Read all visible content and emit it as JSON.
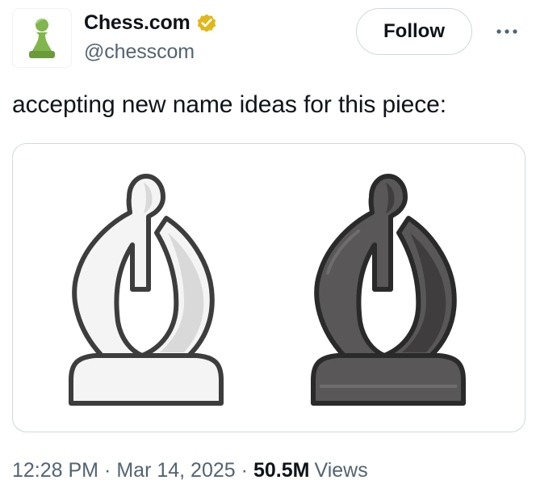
{
  "author": {
    "display_name": "Chess.com",
    "handle": "@chesscom",
    "verified": true,
    "verified_badge_color": "#e2b719",
    "avatar_icon": "chess-pawn-icon",
    "avatar_color": "#81b64c"
  },
  "actions": {
    "follow_label": "Follow",
    "more_icon": "more-horizontal-icon"
  },
  "tweet": {
    "text": "accepting new name ideas for this piece:"
  },
  "media": {
    "pieces": [
      {
        "name": "white-bishop",
        "fill": "#f4f4f4",
        "shade": "#d9d9d9",
        "outline": "#3d3d3d"
      },
      {
        "name": "black-bishop",
        "fill": "#595757",
        "shade": "#3f3d3d",
        "outline": "#2a2a2a"
      }
    ]
  },
  "meta": {
    "time": "12:28 PM",
    "date": "Mar 14, 2025",
    "separator": "·",
    "views_count": "50.5M",
    "views_label": "Views"
  }
}
